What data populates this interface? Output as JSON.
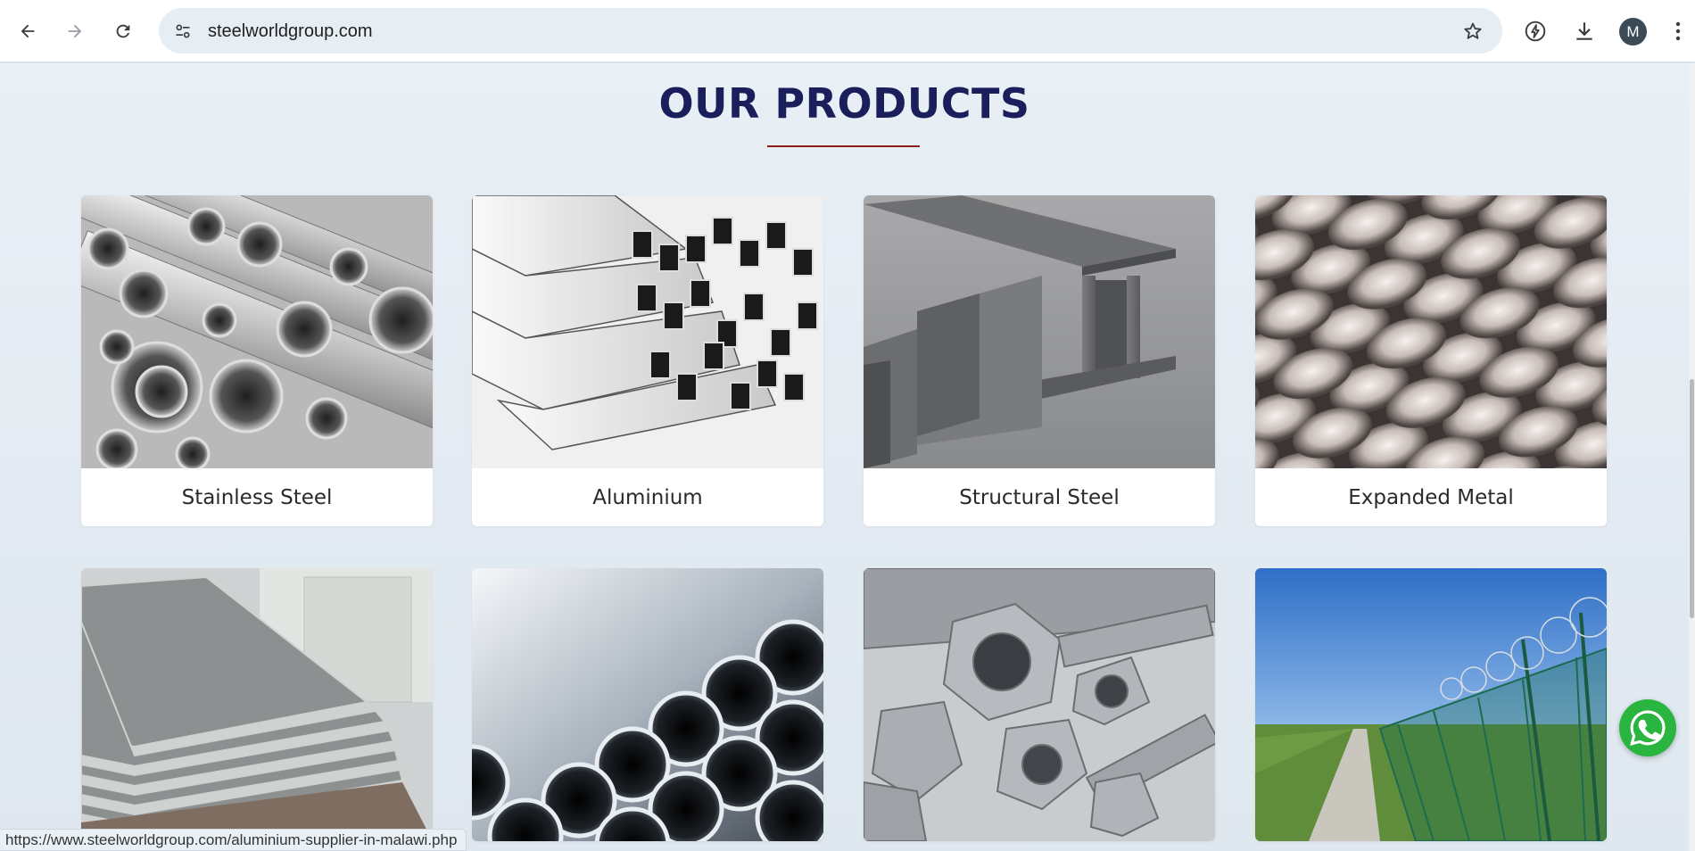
{
  "browser": {
    "url": "steelworldgroup.com",
    "avatar_letter": "M",
    "status_url": "https://www.steelworldgroup.com/aluminium-supplier-in-malawi.php"
  },
  "section": {
    "title": "OUR PRODUCTS",
    "accent_color": "#8b1c1c",
    "title_color": "#1a1f5c"
  },
  "products": [
    {
      "label": "Stainless Steel",
      "image": "stainless-steel-pipes"
    },
    {
      "label": "Aluminium",
      "image": "aluminium-profiles"
    },
    {
      "label": "Structural Steel",
      "image": "structural-steel-beams"
    },
    {
      "label": "Expanded Metal",
      "image": "expanded-metal-mesh"
    },
    {
      "label": "",
      "image": "steel-sheets-stack"
    },
    {
      "label": "",
      "image": "steel-tubes-bundle"
    },
    {
      "label": "",
      "image": "bolts-and-nuts"
    },
    {
      "label": "",
      "image": "razor-wire-fence"
    }
  ],
  "icons": {
    "back": "back-arrow-icon",
    "forward": "forward-arrow-icon",
    "reload": "reload-icon",
    "site_info": "tune-icon",
    "bookmark": "star-icon",
    "extension": "lightning-icon",
    "download": "download-icon",
    "menu": "kebab-menu-icon",
    "chat": "whatsapp-icon"
  }
}
